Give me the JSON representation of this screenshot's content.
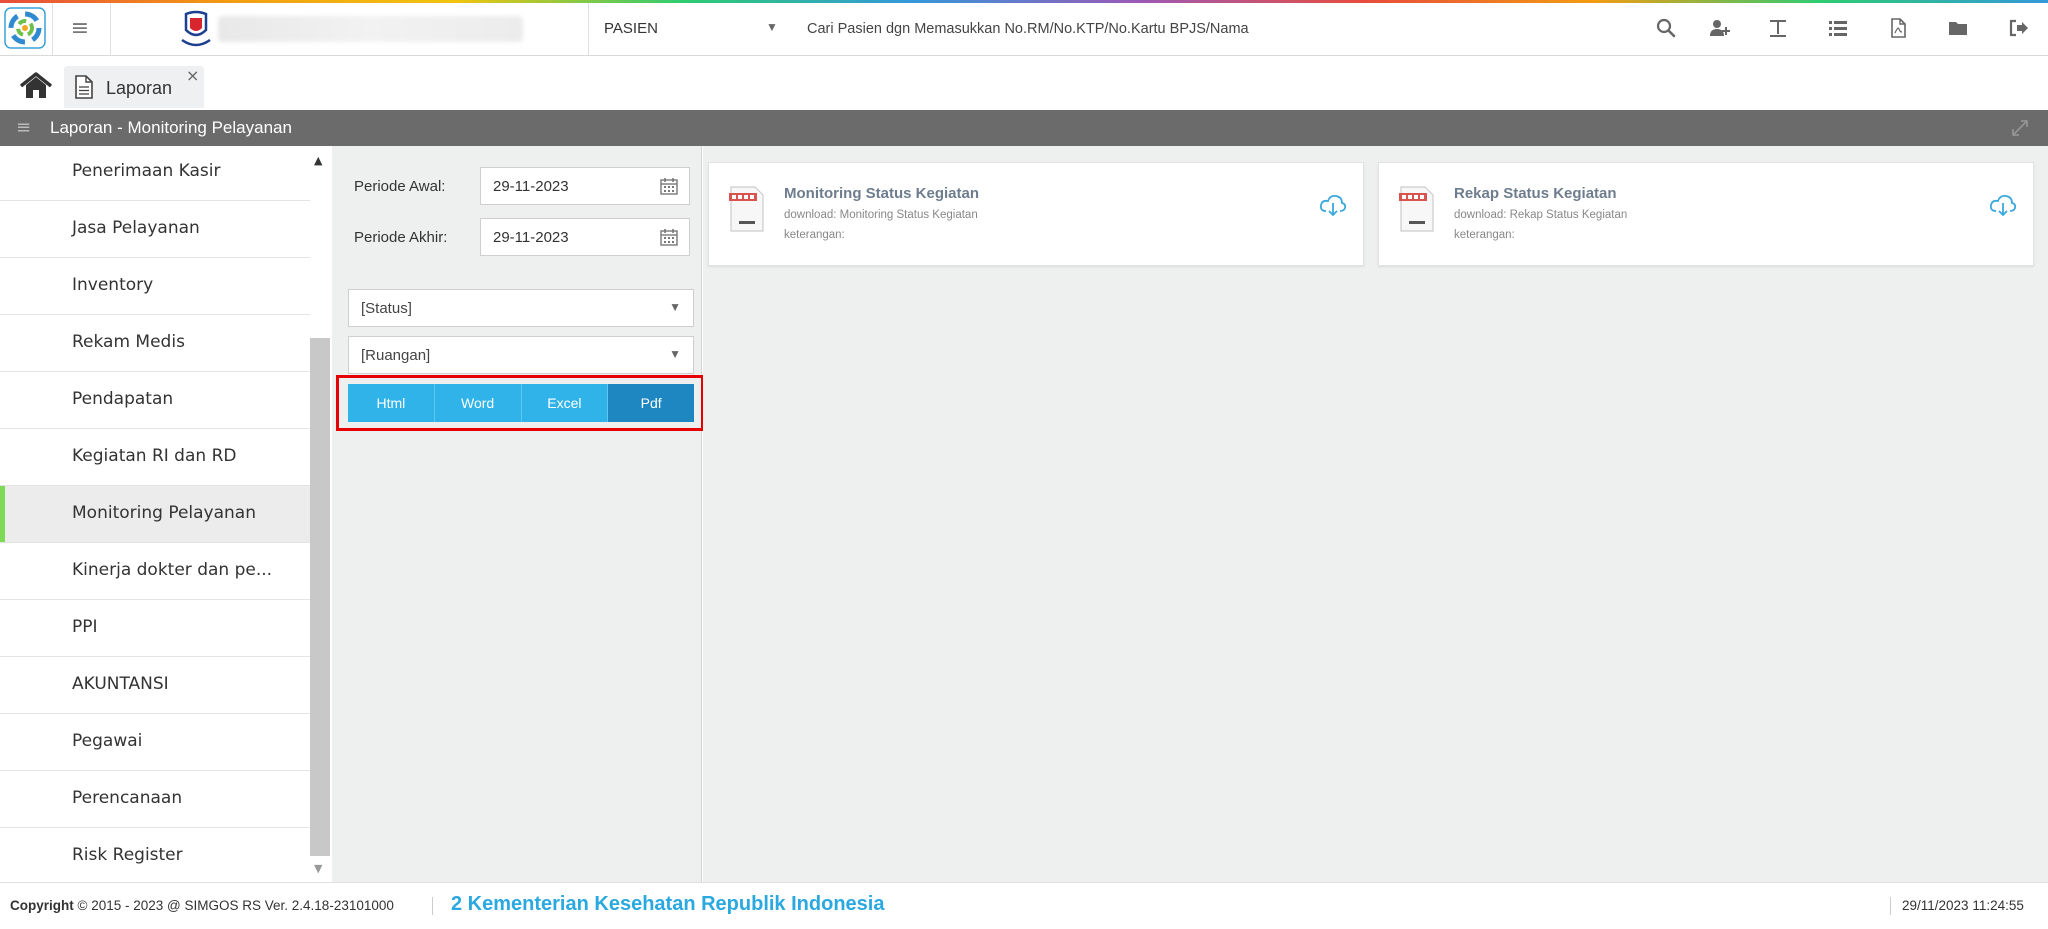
{
  "header": {
    "patient_mode": "PASIEN",
    "search_placeholder": "Cari Pasien dgn Memasukkan No.RM/No.KTP/No.Kartu BPJS/Nama",
    "tools": [
      "search-icon",
      "add-user-icon",
      "text-icon",
      "list-icon",
      "pdf-file-icon",
      "folder-icon",
      "sign-out-icon"
    ]
  },
  "tabs": [
    {
      "label": "Laporan",
      "close": "×"
    }
  ],
  "panel": {
    "title": "Laporan - Monitoring Pelayanan"
  },
  "sidebar": {
    "items": [
      {
        "label": "Penerimaan Kasir"
      },
      {
        "label": "Jasa Pelayanan"
      },
      {
        "label": "Inventory"
      },
      {
        "label": "Rekam Medis"
      },
      {
        "label": "Pendapatan"
      },
      {
        "label": "Kegiatan RI dan RD"
      },
      {
        "label": "Monitoring Pelayanan",
        "active": true
      },
      {
        "label": "Kinerja dokter dan pe..."
      },
      {
        "label": "PPI"
      },
      {
        "label": "AKUNTANSI"
      },
      {
        "label": "Pegawai"
      },
      {
        "label": "Perencanaan"
      },
      {
        "label": "Risk Register"
      }
    ]
  },
  "filters": {
    "periode_awal_label": "Periode Awal:",
    "periode_awal_value": "29-11-2023",
    "periode_akhir_label": "Periode Akhir:",
    "periode_akhir_value": "29-11-2023",
    "status_placeholder": "[Status]",
    "ruangan_placeholder": "[Ruangan]",
    "buttons": [
      "Html",
      "Word",
      "Excel",
      "Pdf"
    ]
  },
  "reports": [
    {
      "title": "Monitoring Status Kegiatan",
      "download": "download: Monitoring Status Kegiatan",
      "keterangan": "keterangan:"
    },
    {
      "title": "Rekap Status Kegiatan",
      "download": "download: Rekap Status Kegiatan",
      "keterangan": "keterangan:"
    }
  ],
  "footer": {
    "copyright_label": "Copyright",
    "copyright_text": "2015 - 2023 @ SIMGOS RS Ver. 2.4.18-23101000",
    "ministry": "2 Kementerian Kesehatan Republik Indonesia",
    "datetime": "29/11/2023 11:24:55"
  },
  "colors": {
    "panel_title_bg": "#6b6b6b",
    "active_indicator": "#7ed957",
    "button_blue": "#2fb3e8",
    "button_pdf": "#1e87c2",
    "highlight": "#e60000",
    "ministry_text": "#2aa8e0"
  }
}
